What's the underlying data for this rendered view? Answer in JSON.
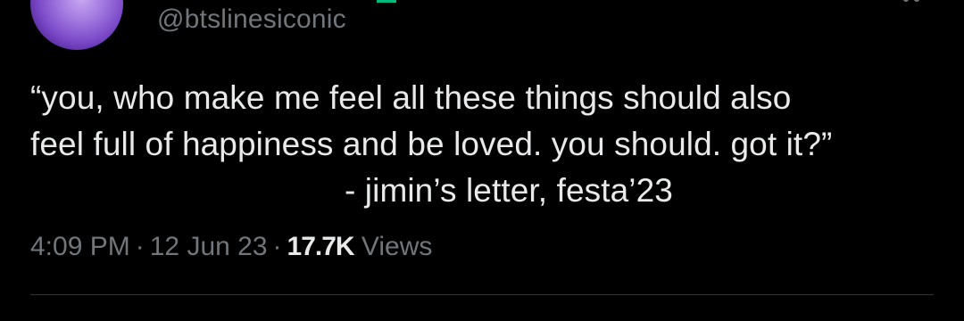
{
  "tweet": {
    "handle": "@btslinesiconic",
    "text_lines": [
      "“you, who make me feel all these things should also",
      "feel full of happiness and be loved. you should. got it?”"
    ],
    "attribution": "- jimin’s letter, festa’23"
  },
  "meta": {
    "time": "4:09 PM",
    "separator": "·",
    "date": "12 Jun 23",
    "views_count": "17.7K",
    "views_label": "Views"
  },
  "colors": {
    "background": "#000000",
    "text_primary": "#e7e9ea",
    "text_secondary": "#71767b",
    "divider": "#2f3336",
    "avatar": "#8a5ad6"
  },
  "icons": {
    "more": "more-dots-icon"
  }
}
